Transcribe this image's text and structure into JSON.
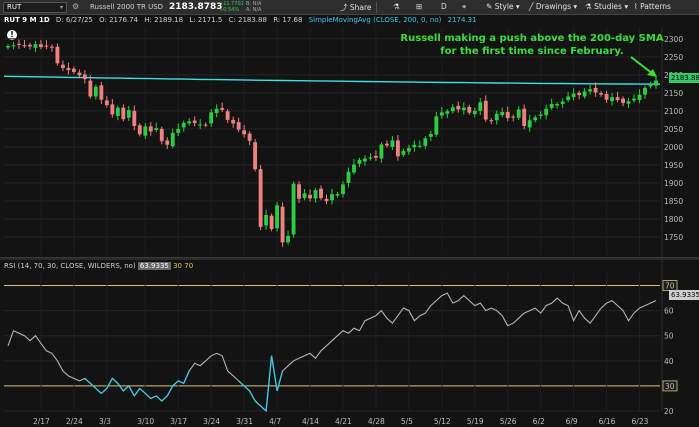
{
  "toolbar": {
    "symbol": "RUT",
    "instrument_name": "Russell 2000 TR USD",
    "last_price": "2183.8783",
    "change_abs": "+11.7702",
    "change_pct": "+0.54%",
    "bid": "B: N/A",
    "ask": "A: N/A",
    "share_label": "Share",
    "timeframe_label": "D",
    "style_label": "Style",
    "drawings_label": "Drawings",
    "studies_label": "Studies",
    "patterns_label": "Patterns"
  },
  "header": {
    "title": "RUT 9 M 1D",
    "date": "D: 6/27/25",
    "open": "O: 2176.74",
    "high": "H: 2189.18",
    "low": "L: 2171.5",
    "close": "C: 2183.88",
    "range": "R: 17.68",
    "study": "SimpleMovingAvg (CLOSE, 200, 0, no)",
    "study_value": "2174.31"
  },
  "annotation": "Russell making a push above the 200-day SMA for the first time since February.",
  "price_tag": "2183.88",
  "rsi_header": {
    "label": "RSI (14, 70, 30, CLOSE, WILDERS, no)",
    "value": "63.9335",
    "oversold": "30",
    "overbought": "70"
  },
  "rsi_tag": "63.9335",
  "colors": {
    "up": "#2ecc40",
    "down": "#f08080",
    "sma": "#3ee0e8",
    "rsi_line": "#b5b5b5",
    "rsi_oversold_highlight": "#3ec8e6",
    "rsi_levels": "#d9c27a",
    "annotation": "#3ddc3d"
  },
  "chart_data": [
    {
      "type": "candlestick",
      "title": "",
      "ylim": [
        1700,
        2330
      ],
      "y_ticks": [
        "2300",
        "2250",
        "2200",
        "2150",
        "2100",
        "2050",
        "2000",
        "1950",
        "1900",
        "1850",
        "1800",
        "1750"
      ],
      "x_ticks": [
        "2/17",
        "2/24",
        "3/3",
        "3/10",
        "3/17",
        "3/24",
        "3/31",
        "4/7",
        "4/14",
        "4/21",
        "4/28",
        "5/5",
        "5/12",
        "5/19",
        "5/26",
        "6/2",
        "6/9",
        "6/16",
        "6/23"
      ],
      "close": [
        2280,
        2282,
        2284,
        2281,
        2279,
        2285,
        2277,
        2280,
        2276,
        2232,
        2219,
        2213,
        2208,
        2199,
        2188,
        2140,
        2167,
        2131,
        2116,
        2090,
        2109,
        2077,
        2102,
        2058,
        2035,
        2057,
        2043,
        2052,
        2016,
        2006,
        2039,
        2050,
        2067,
        2071,
        2066,
        2062,
        2061,
        2096,
        2106,
        2103,
        2075,
        2065,
        2048,
        2035,
        2017,
        1938,
        1778,
        1811,
        1772,
        1838,
        1735,
        1753,
        1898,
        1856,
        1871,
        1857,
        1880,
        1858,
        1850,
        1869,
        1869,
        1896,
        1931,
        1951,
        1964,
        1968,
        1971,
        1970,
        2007,
        2004,
        2018,
        1974,
        1989,
        1997,
        2006,
        2003,
        2024,
        2036,
        2085,
        2096,
        2099,
        2110,
        2104,
        2109,
        2095,
        2100,
        2124,
        2076,
        2072,
        2092,
        2097,
        2080,
        2083,
        2104,
        2058,
        2074,
        2082,
        2090,
        2106,
        2119,
        2119,
        2126,
        2140,
        2148,
        2144,
        2154,
        2160,
        2151,
        2145,
        2131,
        2138,
        2130,
        2122,
        2127,
        2134,
        2145,
        2164,
        2172,
        2184
      ],
      "sma_200": {
        "start": 2196,
        "end": 2174.31
      },
      "current_close": 2183.88,
      "legend": "SimpleMovingAvg (CLOSE, 200, 0, no)"
    },
    {
      "type": "line",
      "title": "RSI (14, 70, 30, CLOSE, WILDERS, no)",
      "ylim": [
        20,
        75
      ],
      "y_ticks": [
        "70",
        "60",
        "50",
        "40",
        "30",
        "20"
      ],
      "levels": [
        30,
        70
      ],
      "values": [
        46,
        52,
        51,
        50,
        48,
        50,
        47,
        44,
        43,
        40,
        36,
        34,
        33,
        32,
        33,
        31,
        29,
        27,
        29,
        33,
        31,
        28,
        30,
        26,
        29,
        27,
        25,
        26,
        24,
        26,
        30,
        32,
        31,
        36,
        39,
        38,
        40,
        42,
        43,
        42,
        36,
        34,
        32,
        30,
        28,
        24,
        22,
        20,
        42,
        28,
        36,
        38,
        40,
        41,
        42,
        43,
        41,
        44,
        46,
        48,
        50,
        52,
        51,
        53,
        52,
        56,
        57,
        58,
        60,
        57,
        55,
        58,
        61,
        60,
        56,
        58,
        59,
        62,
        64,
        66,
        67,
        63,
        64,
        66,
        64,
        62,
        63,
        60,
        61,
        60,
        58,
        54,
        55,
        57,
        59,
        60,
        61,
        59,
        62,
        63,
        65,
        63,
        62,
        56,
        60,
        57,
        55,
        58,
        61,
        63,
        64,
        62,
        60,
        56,
        59,
        61,
        62,
        63,
        64
      ],
      "current": 63.9335
    }
  ]
}
